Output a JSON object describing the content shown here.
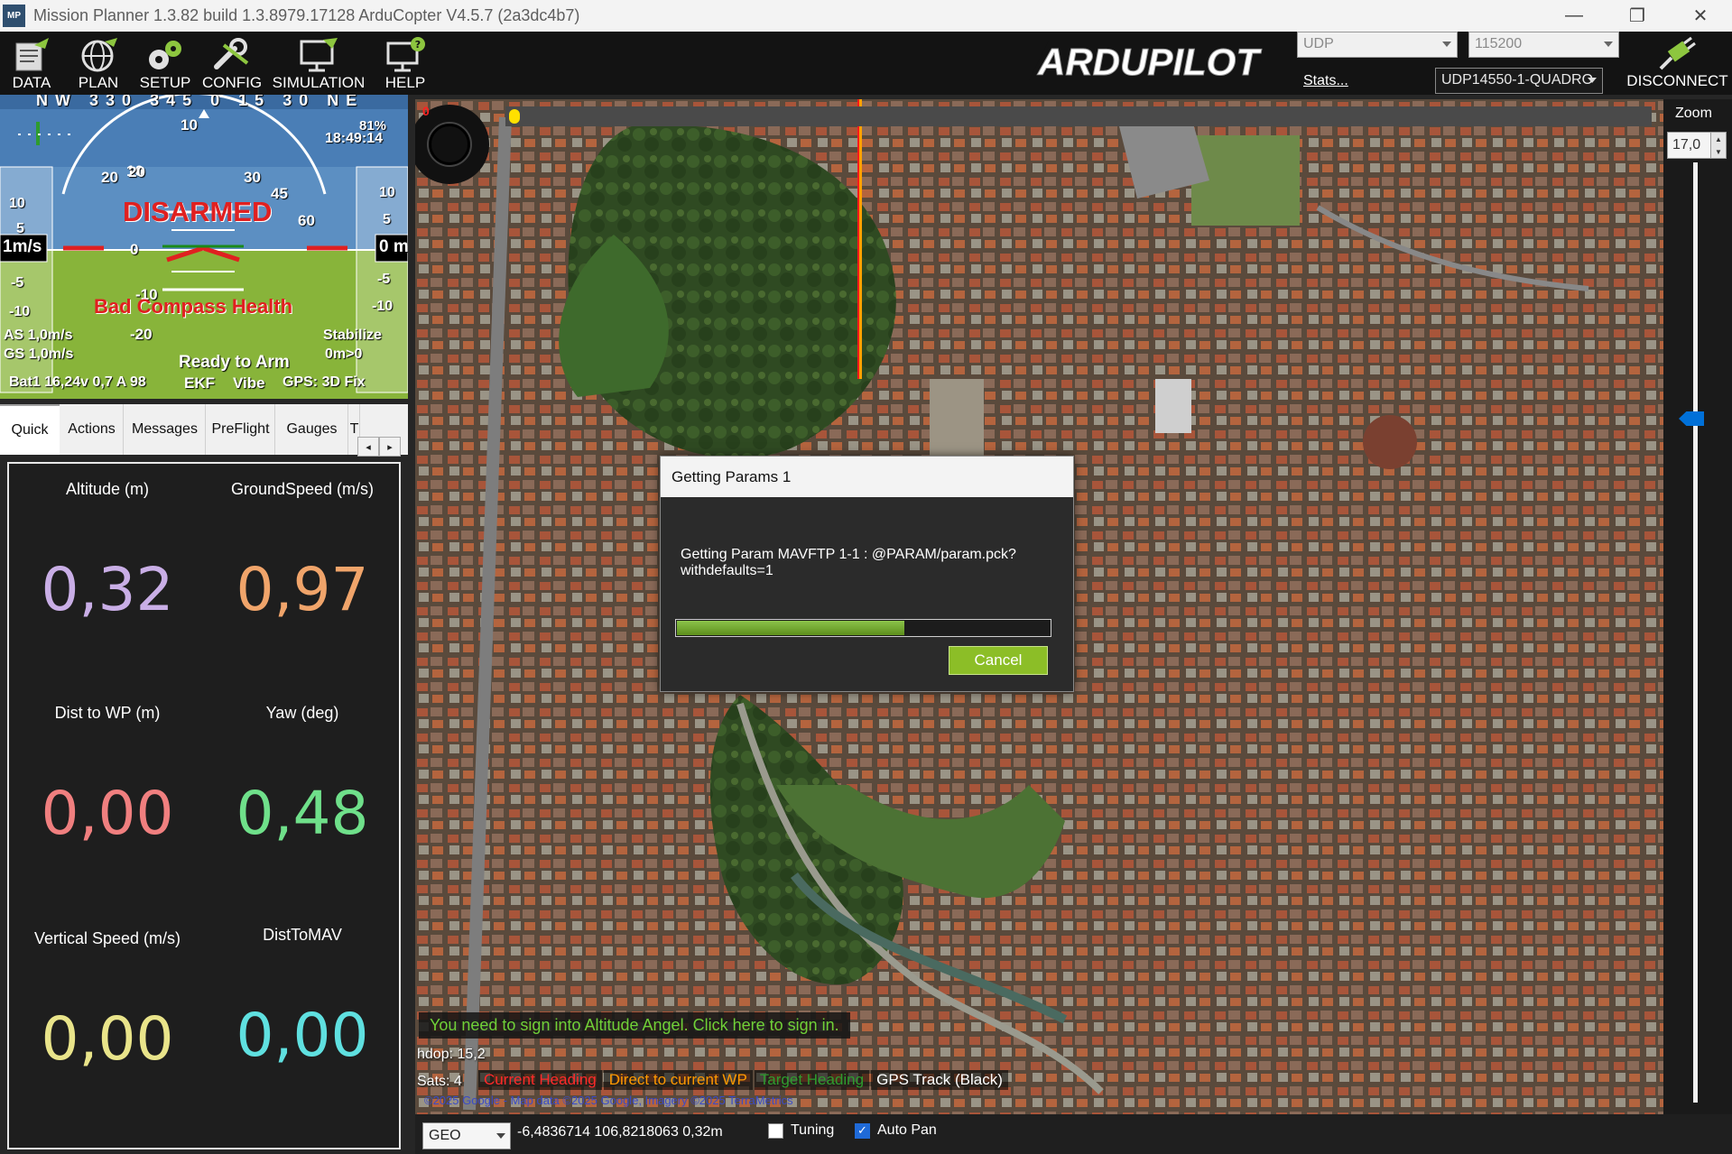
{
  "window": {
    "title": "Mission Planner 1.3.82 build 1.3.8979.17128 ArduCopter V4.5.7 (2a3dc4b7)",
    "app_icon": "MP",
    "minimize": "—",
    "maximize": "❐",
    "close": "✕"
  },
  "menu": {
    "items": [
      {
        "label": "DATA",
        "icon": "data-icon"
      },
      {
        "label": "PLAN",
        "icon": "globe-icon"
      },
      {
        "label": "SETUP",
        "icon": "gears-icon"
      },
      {
        "label": "CONFIG",
        "icon": "wrench-icon"
      },
      {
        "label": "SIMULATION",
        "icon": "monitor-plane-icon"
      },
      {
        "label": "HELP",
        "icon": "monitor-help-icon"
      }
    ],
    "logo_text": "ARDUPILOT",
    "connection_type": "UDP",
    "baud_rate": "115200",
    "stats_link": "Stats...",
    "connection_profile": "UDP14550-1-QUADRO",
    "disconnect_label": "DISCONNECT"
  },
  "hud": {
    "compass": [
      "NW",
      "330",
      "345",
      "0",
      "15",
      "30",
      "NE"
    ],
    "status": "DISARMED",
    "warning": "Bad Compass Health",
    "ready": "Ready to Arm",
    "airspeed": "AS 1,0m/s",
    "groundspeed": "GS 1,0m/s",
    "mode": "Stabilize",
    "dist": "0m>0",
    "battery": "Bat1 16,24v 0,7 A 98",
    "ekf": "EKF",
    "vibe": "Vibe",
    "gps": "GPS: 3D Fix",
    "speed_box": "1m/s",
    "alt_box": "0 m",
    "signal": "81%",
    "time": "18:49:14",
    "pitch_labels": [
      "20",
      "10",
      "0",
      "-10",
      "-20"
    ],
    "roll_labels": [
      "10",
      "20",
      "30",
      "45",
      "60"
    ],
    "speed_ticks": [
      "10",
      "5",
      "-5",
      "-10"
    ],
    "alt_ticks": [
      "10",
      "5",
      "-5",
      "-10"
    ]
  },
  "tabs": [
    {
      "label": "Quick",
      "active": true
    },
    {
      "label": "Actions",
      "active": false
    },
    {
      "label": "Messages",
      "active": false
    },
    {
      "label": "PreFlight",
      "active": false
    },
    {
      "label": "Gauges",
      "active": false
    },
    {
      "label": "T",
      "active": false
    }
  ],
  "tab_scroll": {
    "left": "◂",
    "right": "▸"
  },
  "quick": [
    {
      "label": "Altitude (m)",
      "value": "0,32",
      "color": "#c9aee6"
    },
    {
      "label": "GroundSpeed (m/s)",
      "value": "0,97",
      "color": "#f0a46a"
    },
    {
      "label": "Dist to WP (m)",
      "value": "0,00",
      "color": "#f07f7f"
    },
    {
      "label": "Yaw (deg)",
      "value": "0,48",
      "color": "#6fe08a"
    },
    {
      "label": "Vertical Speed (m/s)",
      "value": "0,00",
      "color": "#e9e48a"
    },
    {
      "label": "DistToMAV",
      "value": "0,00",
      "color": "#5fe0e0"
    }
  ],
  "map": {
    "zoom_label": "Zoom",
    "zoom_value": "17,0",
    "zoom_level_fraction": 0.37,
    "slider_marker": "0",
    "altitude_angel_msg": "You need to sign into Altitude Angel. Click here to sign in.",
    "hdop": "hdop: 15,2",
    "sats": "Sats: 4",
    "legend": [
      {
        "label": "Current Heading",
        "color": "#ff2a2a"
      },
      {
        "label": "Direct to current WP",
        "color": "#ff9900"
      },
      {
        "label": "Target Heading",
        "color": "#2e9c2e"
      },
      {
        "label": "GPS Track (Black)",
        "color": "#ffffff"
      }
    ],
    "copyright": "©2025 Google - Map data ©2025 Google, Imagery ©2025 TerraMetrics"
  },
  "statusbar": {
    "coord_system": "GEO",
    "coords": "-6,4836714 106,8218063   0,32m",
    "tuning_label": "Tuning",
    "tuning_checked": false,
    "autopan_label": "Auto Pan",
    "autopan_checked": true
  },
  "dialog": {
    "title": "Getting Params 1",
    "message": "Getting Param MAVFTP 1-1 : @PARAM/param.pck?withdefaults=1",
    "progress": 0.61,
    "cancel": "Cancel"
  }
}
